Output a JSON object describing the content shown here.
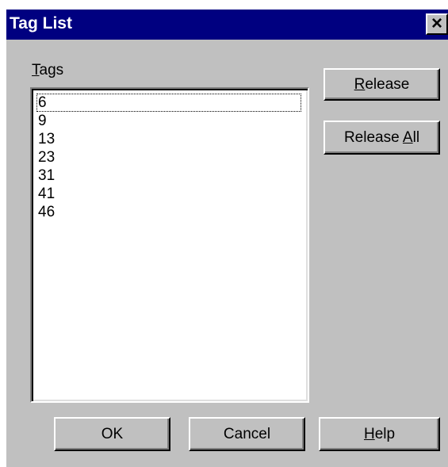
{
  "window": {
    "title": "Tag List",
    "close_glyph": "×"
  },
  "tags": {
    "label_mnemonic": "T",
    "label_rest": "ags",
    "items": [
      "6",
      "9",
      "13",
      "23",
      "31",
      "41",
      "46"
    ],
    "focused_item": "6"
  },
  "buttons": {
    "release": {
      "mnemonic": "R",
      "rest": "elease"
    },
    "release_all": {
      "prefix": "Release ",
      "mnemonic": "A",
      "rest": "ll"
    },
    "ok": "OK",
    "cancel": "Cancel",
    "help": {
      "mnemonic": "H",
      "rest": "elp"
    }
  },
  "colors": {
    "titlebar": "#000080",
    "face": "#c0c0c0",
    "listbox_bg": "#ffffff"
  },
  "icons": {
    "close": "close-icon"
  }
}
